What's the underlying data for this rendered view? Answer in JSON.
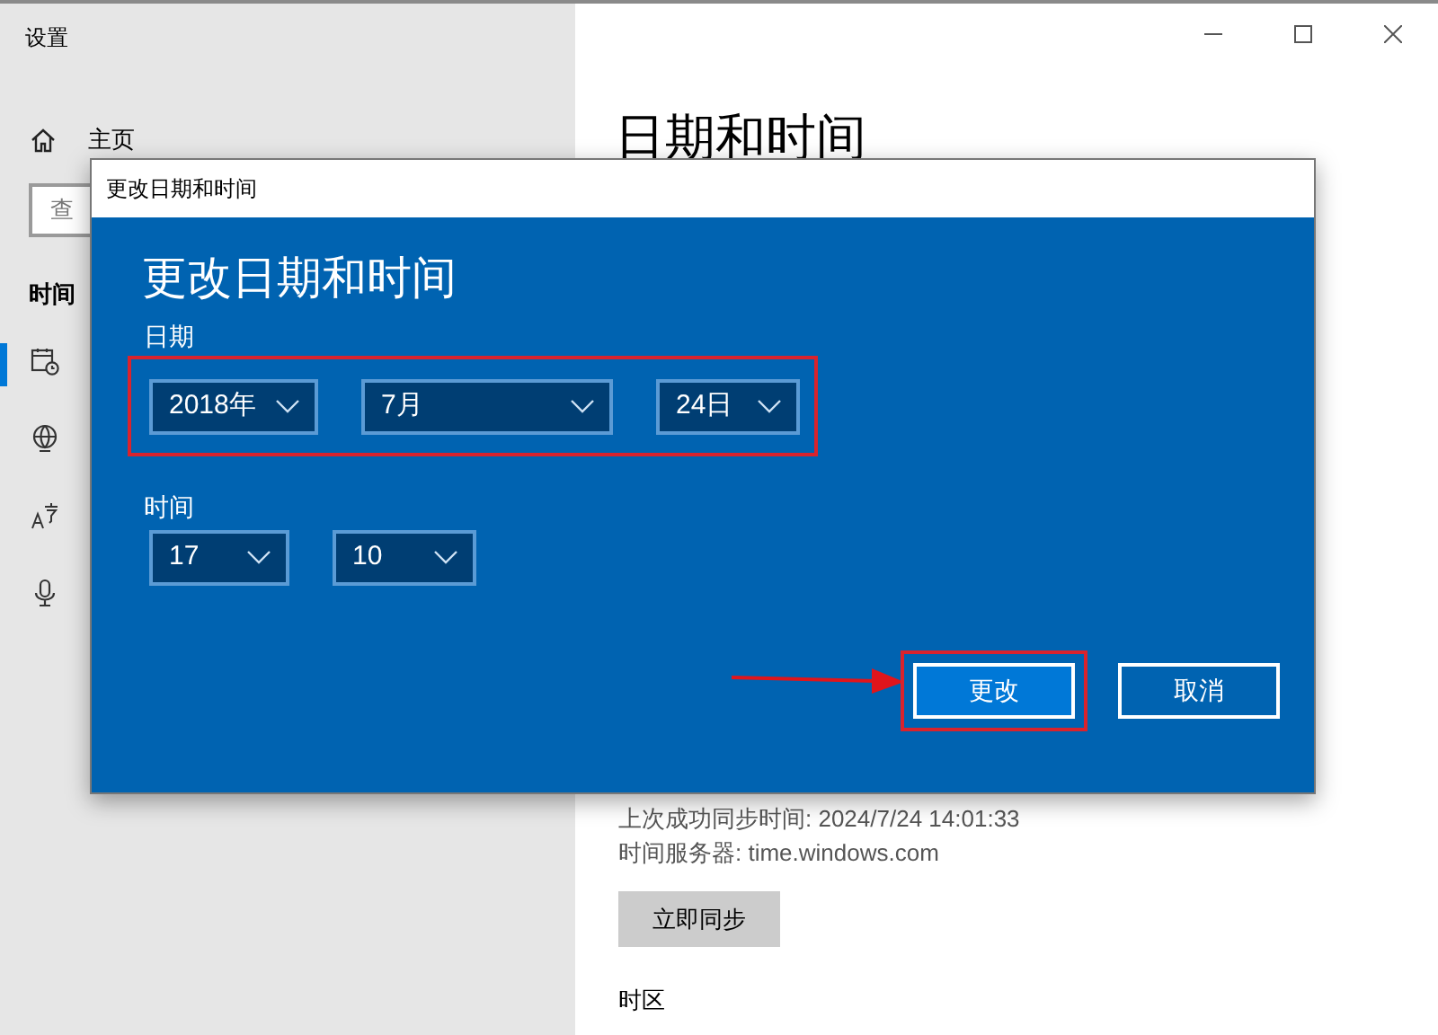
{
  "window": {
    "title": "设置"
  },
  "sidebar": {
    "home": "主页",
    "search": {
      "placeholder": "查"
    },
    "section": "时间"
  },
  "page": {
    "title": "日期和时间",
    "last_sync": "上次成功同步时间: 2024/7/24 14:01:33",
    "time_server": "时间服务器: time.windows.com",
    "sync_button": "立即同步",
    "timezone_heading": "时区"
  },
  "dialog": {
    "title": "更改日期和时间",
    "heading": "更改日期和时间",
    "date": {
      "label": "日期",
      "highlighted": true,
      "selects": [
        {
          "value": "2018年"
        },
        {
          "value": "7月"
        },
        {
          "value": "24日"
        }
      ]
    },
    "time": {
      "label": "时间",
      "highlighted": false,
      "selects": [
        {
          "value": "17"
        },
        {
          "value": "10"
        }
      ]
    },
    "buttons": [
      {
        "label": "更改",
        "kind": "primary",
        "highlighted": true
      },
      {
        "label": "取消",
        "kind": "secondary",
        "highlighted": false
      }
    ]
  }
}
